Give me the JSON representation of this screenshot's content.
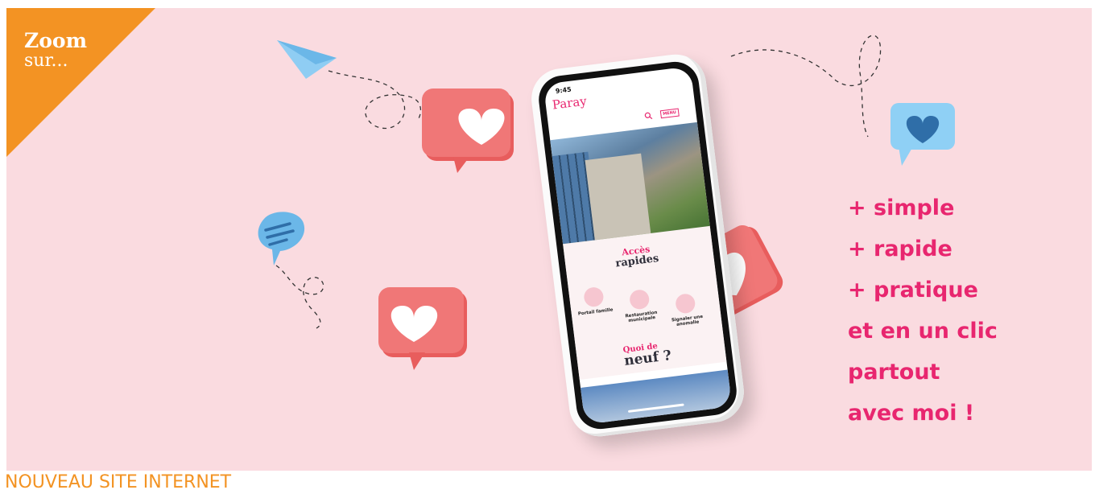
{
  "corner": {
    "title": "Zoom",
    "subtitle": "sur..."
  },
  "banner": {
    "label": "NOUVEAU SITE INTERNET"
  },
  "tagline": {
    "lines": [
      "+ simple",
      "+ rapide",
      "+ pratique",
      "et en un clic",
      "partout",
      "avec moi !"
    ]
  },
  "phone": {
    "time": "9:45",
    "logo": "Paray",
    "menu_label": "MENU",
    "acces_title_1": "Accès",
    "acces_title_2": "rapides",
    "quick_access": [
      "Portail famille",
      "Restauration municipale",
      "Signaler une anomalie"
    ],
    "news_title_1": "Quoi de",
    "news_title_2": "neuf ?"
  },
  "colors": {
    "background": "#fadbe0",
    "accent": "#e8266f",
    "corner": "#f39323",
    "heart_bubble": "#ef6a6a",
    "blue_bubble": "#7fc4ee"
  }
}
